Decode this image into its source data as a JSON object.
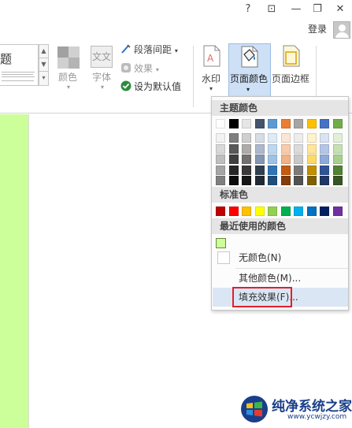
{
  "titlebar": {
    "help": "?",
    "ribbon_options": "⊡",
    "minimize": "—",
    "restore": "❐",
    "close": "✕",
    "sign_in": "登录"
  },
  "ribbon": {
    "theme_gallery_text": "题",
    "colors_label": "颜色",
    "fonts_label": "字体",
    "fonts_icon_text": "文文",
    "paragraph_spacing_label": "段落间距",
    "effects_label": "效果",
    "set_default_label": "设为默认值",
    "watermark_label": "水印",
    "page_color_label": "页面颜色",
    "page_borders_label": "页面边框"
  },
  "menu": {
    "theme_colors_header": "主题颜色",
    "standard_colors_header": "标准色",
    "recent_colors_header": "最近使用的颜色",
    "no_color_label": "无颜色(N)",
    "more_colors_label": "其他颜色(M)...",
    "fill_effects_label": "填充效果(F)..."
  },
  "colors": {
    "theme_base": [
      "#ffffff",
      "#000000",
      "#e7e6e6",
      "#44546a",
      "#5b9bd5",
      "#ed7d31",
      "#a5a5a5",
      "#ffc000",
      "#4472c4",
      "#70ad47"
    ],
    "theme_shades": [
      [
        "#f2f2f2",
        "#7f7f7f",
        "#d0cece",
        "#d6dce4",
        "#deebf6",
        "#fbe5d5",
        "#ededed",
        "#fff2cc",
        "#dae3f3",
        "#e2efd9"
      ],
      [
        "#d8d8d8",
        "#595959",
        "#aeabab",
        "#adb9ca",
        "#bdd7ee",
        "#f7cbac",
        "#dbdbdb",
        "#fee599",
        "#b4c6e7",
        "#c5e0b3"
      ],
      [
        "#bfbfbf",
        "#3f3f3f",
        "#757070",
        "#8496b0",
        "#9cc3e5",
        "#f4b183",
        "#c9c9c9",
        "#ffd965",
        "#8eaadb",
        "#a8d08d"
      ],
      [
        "#a5a5a5",
        "#262626",
        "#3a3838",
        "#323f4f",
        "#2e75b5",
        "#c55a11",
        "#7b7b7b",
        "#bf9000",
        "#2f5496",
        "#538135"
      ],
      [
        "#7f7f7f",
        "#0c0c0c",
        "#171616",
        "#222a35",
        "#1e4e79",
        "#833c0b",
        "#525252",
        "#7f6000",
        "#1f3864",
        "#375623"
      ]
    ],
    "standard": [
      "#c00000",
      "#ff0000",
      "#ffc000",
      "#ffff00",
      "#92d050",
      "#00b050",
      "#00b0f0",
      "#0070c0",
      "#002060",
      "#7030a0"
    ],
    "recent": [
      "#ccff99"
    ],
    "page_background": "#ccff99",
    "highlight": "#e0202a"
  },
  "watermark": {
    "title": "纯净系统之家",
    "url": "www.ycwjzy.com"
  }
}
